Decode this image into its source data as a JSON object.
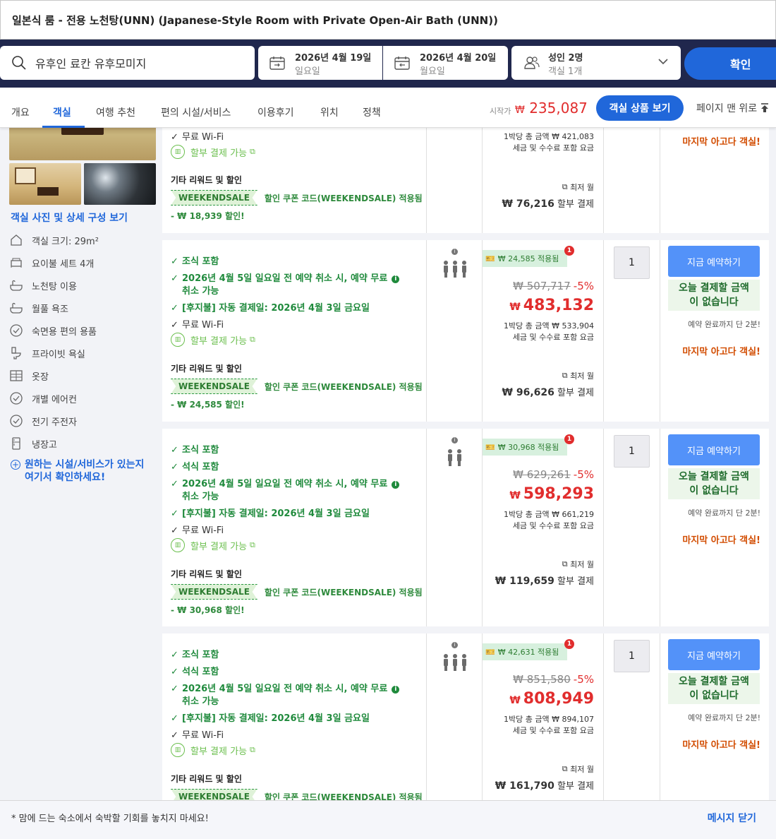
{
  "title": "일본식 룸 - 전용 노천탕(UNN) (Japanese-Style Room with Private Open-Air Bath (UNN))",
  "search": {
    "destination": "유후인 료칸 유후모미지",
    "checkin_date": "2026년 4월 19일",
    "checkin_day": "일요일",
    "checkout_date": "2026년 4월 20일",
    "checkout_day": "월요일",
    "guests": "성인 2명",
    "rooms": "객실 1개",
    "confirm_label": "확인"
  },
  "tabs": [
    "개요",
    "객실",
    "여행 추천",
    "편의 시설/서비스",
    "이용후기",
    "위치",
    "정책"
  ],
  "price_bar": {
    "from_label": "시작가",
    "currency": "₩",
    "from_price": "235,087",
    "view_rooms_label": "객실 상품 보기",
    "back_to_top_label": "페이지 맨 위로"
  },
  "left": {
    "photo_link": "객실 사진 및 상세 구성 보기",
    "amenities": [
      "객실 크기: 29m²",
      "요이불 세트 4개",
      "노천탕 이용",
      "월풀 욕조",
      "숙면용 편의 용품",
      "프라이빗 욕실",
      "옷장",
      "개별 에어컨",
      "전기 주전자",
      "냉장고"
    ],
    "want_line1": "원하는 시설/서비스가 있는지",
    "want_line2": "여기서 확인하세요!"
  },
  "labels": {
    "installment": "할부 결제 가능",
    "rewards_title": "기타 리워드 및 할인",
    "coupon_tag": "WEEKENDSALE",
    "coupon_desc": "할인 쿠폰 코드(WEEKENDSALE) 적용됨",
    "per_night_suffix": "세금 및 수수료 포함 요금",
    "monthly_label": "최저 월",
    "monthly_suffix": "할부 결제",
    "book_now": "지금 예약하기",
    "pay_now_line1": "오늘 결제할 금액",
    "pay_now_line2": "이 없습니다",
    "only_left": "예약 완료까지 단 2분!",
    "last_room": "마지막 아고다 객실!"
  },
  "top_row": {
    "wifi": "무료 Wi-Fi",
    "discount": "- ₩ 18,939 할인!",
    "per_night": "1박당 총 금액 ₩ 421,083",
    "monthly": "₩ 76,216"
  },
  "rows": [
    {
      "benefits": [
        "조식 포함",
        "2026년 4월 5일 일요일 전 예약 취소 시, 예약 무료",
        "취소 가능",
        "[후지불] 자동 결제일: 2026년 4월 3일 금요일",
        "무료 Wi-Fi"
      ],
      "discount": "- ₩ 24,585 할인!",
      "applied": "₩ 24,585 적용됨",
      "badge": "1",
      "orig_price": "₩ 507,717",
      "percent": "-5%",
      "final_currency": "₩",
      "final_price": "483,132",
      "per_night": "1박당 총 금액 ₩ 533,904",
      "monthly": "₩ 96,626",
      "qty": "1"
    },
    {
      "benefits": [
        "조식 포함",
        "석식 포함",
        "2026년 4월 5일 일요일 전 예약 취소 시, 예약 무료",
        "취소 가능",
        "[후지불] 자동 결제일: 2026년 4월 3일 금요일",
        "무료 Wi-Fi"
      ],
      "discount": "- ₩ 30,968 할인!",
      "applied": "₩ 30,968 적용됨",
      "badge": "1",
      "orig_price": "₩ 629,261",
      "percent": "-5%",
      "final_currency": "₩",
      "final_price": "598,293",
      "per_night": "1박당 총 금액 ₩ 661,219",
      "monthly": "₩ 119,659",
      "qty": "1"
    },
    {
      "benefits": [
        "조식 포함",
        "석식 포함",
        "2026년 4월 5일 일요일 전 예약 취소 시, 예약 무료",
        "취소 가능",
        "[후지불] 자동 결제일: 2026년 4월 3일 금요일",
        "무료 Wi-Fi"
      ],
      "applied": "₩ 42,631 적용됨",
      "badge": "1",
      "orig_price": "₩ 851,580",
      "percent": "-5%",
      "final_currency": "₩",
      "final_price": "808,949",
      "per_night": "1박당 총 금액 ₩ 894,107",
      "monthly": "₩ 161,790",
      "qty": "1"
    }
  ],
  "footer": {
    "message": "* 맘에 드는 숙소에서 숙박할 기회를 놓치지 마세요!",
    "close_label": "메시지 닫기"
  }
}
